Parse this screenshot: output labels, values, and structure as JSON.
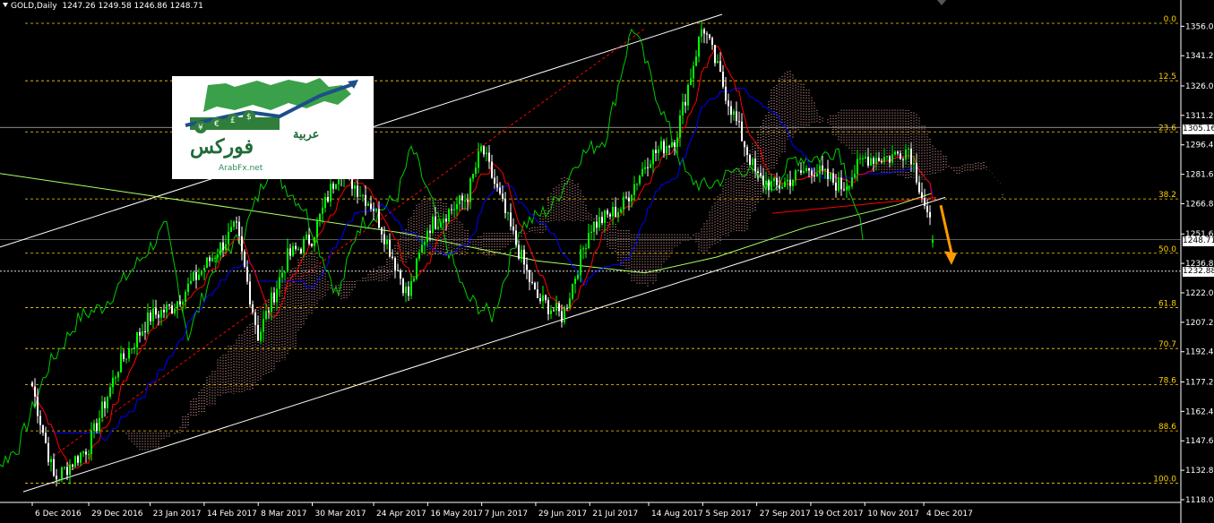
{
  "header": {
    "symbol": "GOLD,Daily",
    "ohlc": "1247.26 1249.58 1246.86 1248.71"
  },
  "logo": {
    "site": "ArabFx.net",
    "text_main": "فوركس",
    "text_sub": "عربية",
    "currency_symbols": [
      "¥",
      "€",
      "£",
      "$"
    ]
  },
  "price_tags": {
    "current": "1248.71",
    "level_upper": "1305.16",
    "level_lower": "1232.88"
  },
  "colors": {
    "background": "#000000",
    "bull_candle": "#00ff00",
    "bear_candle": "#ffffff",
    "tenkan": "#ff0000",
    "kijun": "#0000ff",
    "chikou": "#00cc00",
    "cloud_fill": "#ffb6b0",
    "fib_lines": "#ffd200",
    "channel": "#ffffff",
    "moving_average": "#aaff66",
    "arrow": "#ff9900"
  },
  "chart_data": {
    "type": "candlestick",
    "title": "GOLD,Daily",
    "indicators": [
      "Ichimoku Kinko Hyo",
      "Fibonacci retracement",
      "ascending channel",
      "moving average"
    ],
    "y_axis": {
      "side": "right",
      "range": [
        1118.0,
        1362.0
      ],
      "ticks": [
        "1356.00",
        "1341.20",
        "1326.00",
        "1311.20",
        "1296.40",
        "1281.60",
        "1266.80",
        "1251.60",
        "1236.80",
        "1222.00",
        "1207.20",
        "1192.40",
        "1177.20",
        "1162.40",
        "1147.60",
        "1132.80",
        "1118.00"
      ]
    },
    "x_axis": {
      "ticks": [
        "6 Dec 2016",
        "29 Dec 2016",
        "23 Jan 2017",
        "14 Feb 2017",
        "8 Mar 2017",
        "30 Mar 2017",
        "24 Apr 2017",
        "16 May 2017",
        "7 Jun 2017",
        "29 Jun 2017",
        "21 Jul 2017",
        "14 Aug 2017",
        "5 Sep 2017",
        "27 Sep 2017",
        "19 Oct 2017",
        "10 Nov 2017",
        "4 Dec 2017"
      ]
    },
    "fibonacci": [
      {
        "label": "0.0",
        "price": 1357.5
      },
      {
        "label": "12.5",
        "price": 1328.6
      },
      {
        "label": "23.6",
        "price": 1302.9
      },
      {
        "label": "38.2",
        "price": 1269.2
      },
      {
        "label": "50.0",
        "price": 1241.9
      },
      {
        "label": "61.8",
        "price": 1214.6
      },
      {
        "label": "70.7",
        "price": 1194.0
      },
      {
        "label": "78.6",
        "price": 1175.8
      },
      {
        "label": "88.6",
        "price": 1152.6
      },
      {
        "label": "100.0",
        "price": 1126.3
      }
    ],
    "horizontal_levels": [
      1305.16,
      1248.71,
      1232.88
    ],
    "price_path": [
      [
        "6 Dec 2016",
        1175
      ],
      [
        "15 Dec 2016",
        1128
      ],
      [
        "29 Dec 2016",
        1145
      ],
      [
        "10 Jan 2017",
        1185
      ],
      [
        "23 Jan 2017",
        1210
      ],
      [
        "1 Feb 2017",
        1215
      ],
      [
        "14 Feb 2017",
        1235
      ],
      [
        "27 Feb 2017",
        1255
      ],
      [
        "8 Mar 2017",
        1200
      ],
      [
        "20 Mar 2017",
        1240
      ],
      [
        "30 Mar 2017",
        1250
      ],
      [
        "10 Apr 2017",
        1285
      ],
      [
        "24 Apr 2017",
        1265
      ],
      [
        "8 May 2017",
        1220
      ],
      [
        "16 May 2017",
        1255
      ],
      [
        "1 Jun 2017",
        1270
      ],
      [
        "7 Jun 2017",
        1295
      ],
      [
        "20 Jun 2017",
        1250
      ],
      [
        "29 Jun 2017",
        1220
      ],
      [
        "10 Jul 2017",
        1210
      ],
      [
        "21 Jul 2017",
        1255
      ],
      [
        "3 Aug 2017",
        1265
      ],
      [
        "14 Aug 2017",
        1290
      ],
      [
        "25 Aug 2017",
        1300
      ],
      [
        "5 Sep 2017",
        1357
      ],
      [
        "15 Sep 2017",
        1320
      ],
      [
        "27 Sep 2017",
        1280
      ],
      [
        "5 Oct 2017",
        1275
      ],
      [
        "19 Oct 2017",
        1285
      ],
      [
        "1 Nov 2017",
        1275
      ],
      [
        "10 Nov 2017",
        1290
      ],
      [
        "20 Nov 2017",
        1290
      ],
      [
        "28 Nov 2017",
        1295
      ],
      [
        "4 Dec 2017",
        1268
      ],
      [
        "8 Dec 2017",
        1248.71
      ]
    ]
  }
}
